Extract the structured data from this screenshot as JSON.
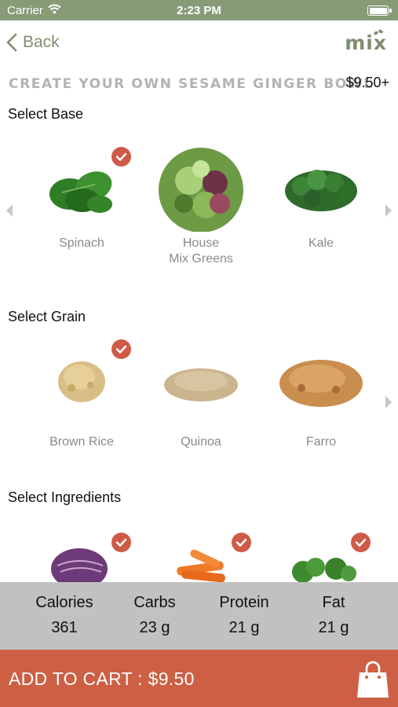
{
  "status": {
    "carrier": "Carrier",
    "time": "2:23 PM"
  },
  "nav": {
    "back_label": "Back",
    "logo": "mix"
  },
  "header": {
    "title": "CREATE YOUR OWN SESAME GINGER BOWL",
    "price": "$9.50+"
  },
  "sections": {
    "base": {
      "title": "Select Base",
      "items": [
        {
          "label": "Spinach",
          "selected": true
        },
        {
          "label": "House\nMix Greens",
          "selected": false
        },
        {
          "label": "Kale",
          "selected": false
        }
      ]
    },
    "grain": {
      "title": "Select Grain",
      "items": [
        {
          "label": "Brown Rice",
          "selected": true
        },
        {
          "label": "Quinoa",
          "selected": false
        },
        {
          "label": "Farro",
          "selected": false
        }
      ]
    },
    "ingredients": {
      "title": "Select Ingredients",
      "items": [
        {
          "label": "Red Cabbage",
          "selected": true
        },
        {
          "label": "Carrots",
          "selected": true
        },
        {
          "label": "Broccoli",
          "selected": true
        }
      ]
    }
  },
  "nutrition": [
    {
      "label": "Calories",
      "value": "361"
    },
    {
      "label": "Carbs",
      "value": "23 g"
    },
    {
      "label": "Protein",
      "value": "21 g"
    },
    {
      "label": "Fat",
      "value": "21 g"
    }
  ],
  "cart": {
    "label": "ADD TO CART : $9.50"
  },
  "colors": {
    "brand_green": "#879b77",
    "accent_red": "#cd5f44",
    "check_red": "#cf5b47",
    "nutrition_bg": "#c1c1c1"
  },
  "icons": [
    "wifi-icon",
    "battery-icon",
    "back-chevron-icon",
    "logo-leaf-icon",
    "check-icon",
    "chevron-left-icon",
    "chevron-right-icon",
    "shopping-bag-icon"
  ]
}
